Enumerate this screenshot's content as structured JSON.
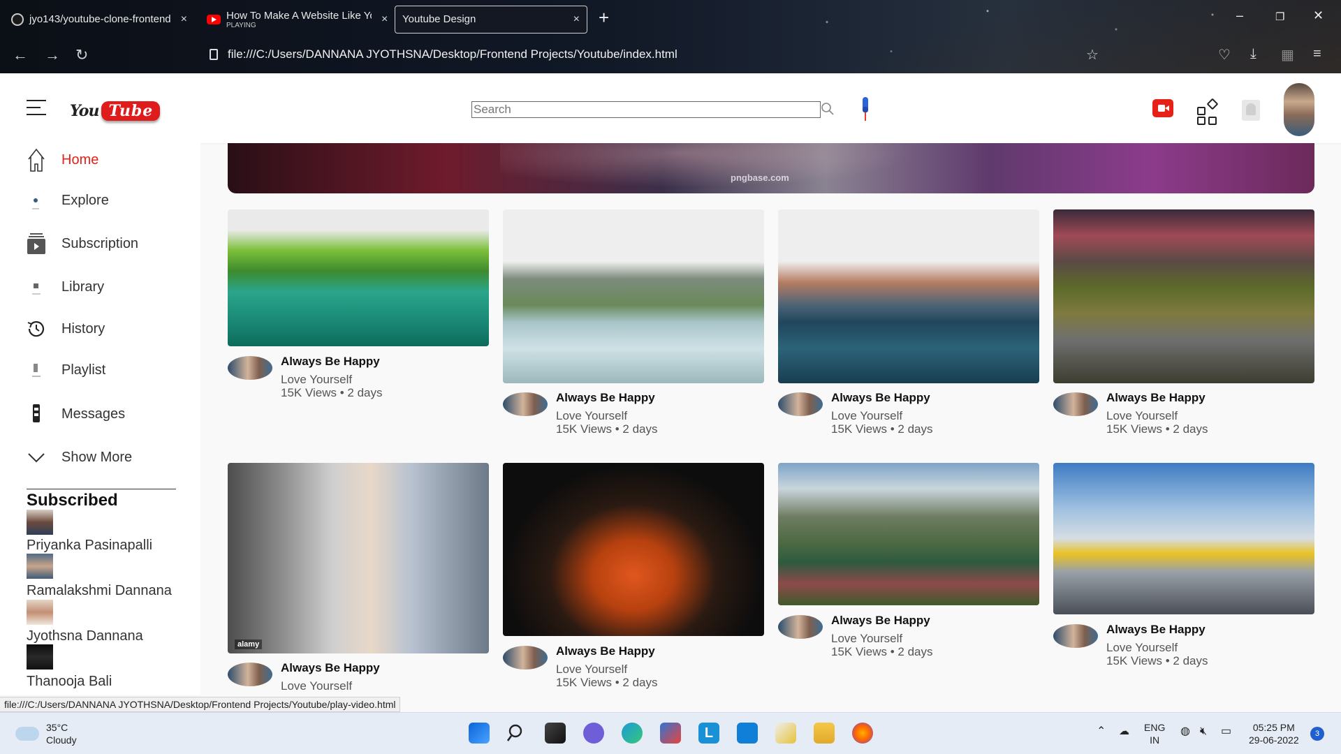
{
  "browser": {
    "tabs": [
      {
        "title": "jyo143/youtube-clone-frontend",
        "subtitle": ""
      },
      {
        "title": "How To Make A Website Like Yo",
        "subtitle": "PLAYING"
      },
      {
        "title": "Youtube Design",
        "subtitle": ""
      }
    ],
    "url": "file:///C:/Users/DANNANA JYOTHSNA/Desktop/Frontend Projects/Youtube/index.html",
    "status_link": "file:///C:/Users/DANNANA JYOTHSNA/Desktop/Frontend Projects/Youtube/play-video.html"
  },
  "header": {
    "logo_you": "You",
    "logo_tube": "Tube",
    "search_placeholder": "Search"
  },
  "sidebar": {
    "items": [
      {
        "label": "Home",
        "icon": "home-icon",
        "active": true
      },
      {
        "label": "Explore",
        "icon": "explore-icon"
      },
      {
        "label": "Subscription",
        "icon": "subscription-icon"
      },
      {
        "label": "Library",
        "icon": "library-icon"
      },
      {
        "label": "History",
        "icon": "history-icon"
      },
      {
        "label": "Playlist",
        "icon": "playlist-icon"
      },
      {
        "label": "Messages",
        "icon": "messages-icon"
      },
      {
        "label": "Show More",
        "icon": "chevron-down-icon"
      }
    ],
    "subscribed_title": "Subscribed",
    "subscriptions": [
      "Priyanka Pasinapalli",
      "Ramalakshmi Dannana",
      "Jyothsna Dannana",
      "Thanooja Bali"
    ]
  },
  "banner": {
    "watermark": "pngbase.com"
  },
  "videos": [
    {
      "title": "Always Be Happy",
      "channel": "Love Yourself",
      "stats": "15K Views • 2 days",
      "thumb": "green lake"
    },
    {
      "title": "Always Be Happy",
      "channel": "Love Yourself",
      "stats": "15K Views • 2 days",
      "thumb": "river mountains"
    },
    {
      "title": "Always Be Happy",
      "channel": "Love Yourself",
      "stats": "15K Views • 2 days",
      "thumb": "sunset lake"
    },
    {
      "title": "Always Be Happy",
      "channel": "Love Yourself",
      "stats": "15K Views • 2 days",
      "thumb": "valley river"
    },
    {
      "title": "Always Be Happy",
      "channel": "Love Yourself",
      "stats": "",
      "thumb": "friends bikes",
      "watermark": "alamy"
    },
    {
      "title": "Always Be Happy",
      "channel": "Love Yourself",
      "stats": "15K Views • 2 days",
      "thumb": "orange sports car"
    },
    {
      "title": "Always Be Happy",
      "channel": "Love Yourself",
      "stats": "15K Views • 2 days",
      "thumb": "mountain lake flowers"
    },
    {
      "title": "Always Be Happy",
      "channel": "Love Yourself",
      "stats": "15K Views • 2 days",
      "thumb": "yellow sports car"
    }
  ],
  "taskbar": {
    "temperature": "35°C",
    "weather": "Cloudy",
    "lang_1": "ENG",
    "lang_2": "IN",
    "time": "05:25 PM",
    "date": "29-06-2022",
    "notifications": "3"
  }
}
